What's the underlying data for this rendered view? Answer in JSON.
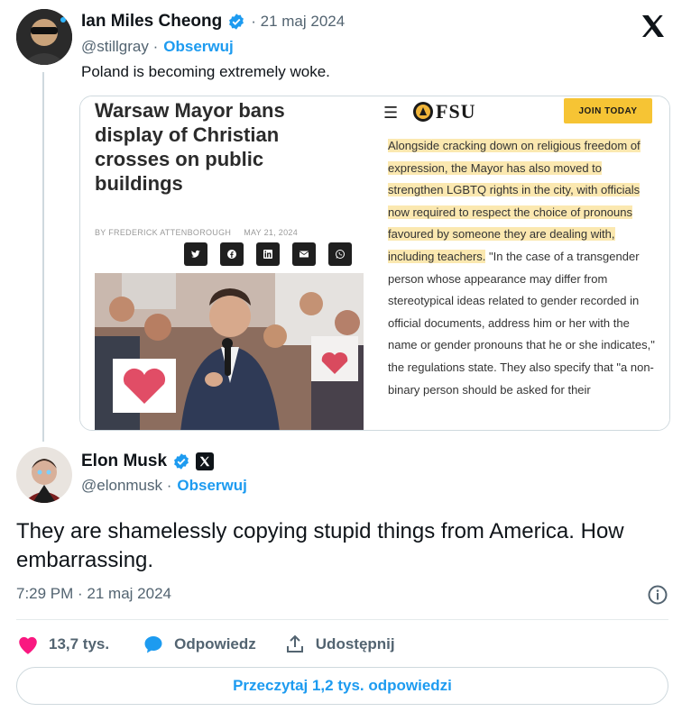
{
  "quoted_tweet": {
    "author_name": "Ian Miles Cheong",
    "date": "· 21 maj 2024",
    "handle": "@stillgray ·",
    "follow_label": "Obserwuj",
    "text": "Poland is becoming extremely woke."
  },
  "article": {
    "headline": "Warsaw Mayor bans display of Christian crosses on public buildings",
    "byline_author": "BY FREDERICK ATTENBOROUGH",
    "byline_date": "MAY 21, 2024",
    "site_name": "FSU",
    "join_label": "JOIN TODAY",
    "highlighted_text": "Alongside cracking down on religious freedom of expression, the Mayor has also moved to strengthen LGBTQ rights in the city, with officials now required to respect the choice of pronouns favoured by someone they are dealing with, including teachers.",
    "body_text": " \"In the case of a transgender person whose appearance may differ from stereotypical ideas related to gender recorded in official documents, address him or her with the name or gender pronouns that he or she indicates,\" the regulations state. They also specify that \"a non-binary person should be asked for their"
  },
  "main_tweet": {
    "author_name": "Elon Musk",
    "handle": "@elonmusk ·",
    "follow_label": "Obserwuj",
    "text": "They are shamelessly copying stupid things from America. How embarrassing.",
    "timestamp": "7:29 PM · 21 maj 2024"
  },
  "actions": {
    "likes": "13,7 tys.",
    "reply_label": "Odpowiedz",
    "share_label": "Udostępnij"
  },
  "read_replies_label": "Przeczytaj 1,2 tys. odpowiedzi",
  "colors": {
    "accent": "#1d9bf0",
    "like": "#f91880",
    "text": "#0f1419",
    "muted": "#536471",
    "highlight": "#fbe8b0"
  }
}
